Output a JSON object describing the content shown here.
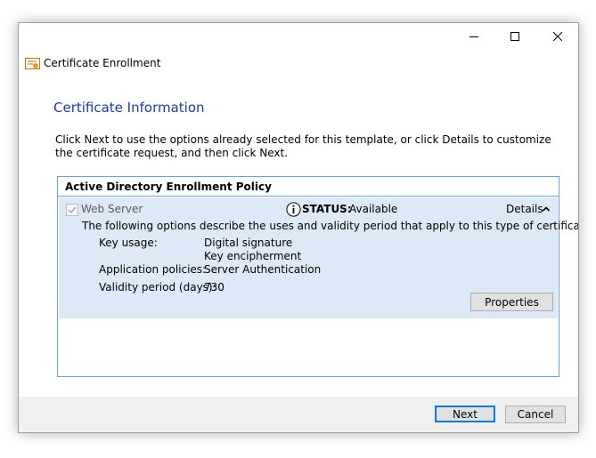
{
  "window": {
    "title": "Certificate Enrollment",
    "controls": [
      "minimize-icon",
      "maximize-icon",
      "close-icon"
    ]
  },
  "page": {
    "heading": "Certificate Information",
    "instructions": "Click Next to use the options already selected for this template, or click Details to customize the certificate request, and then click Next."
  },
  "policy": {
    "header": "Active Directory Enrollment Policy",
    "entry": {
      "checked": true,
      "name": "Web Server",
      "status_label": "STATUS:",
      "status_value": "Available",
      "details_label": "Details",
      "description": "The following options describe the uses and validity period that apply to this type of certificate:",
      "key_usage_label": "Key usage:",
      "key_usage_values": [
        "Digital signature",
        "Key encipherment"
      ],
      "app_policies_label": "Application policies:",
      "app_policies_value": "Server Authentication",
      "validity_label": "Validity period (days):",
      "validity_value": "730",
      "properties_label": "Properties"
    }
  },
  "footer": {
    "next_label": "Next",
    "cancel_label": "Cancel"
  },
  "colors": {
    "heading": "#1f3f8f",
    "entry_background": "#dde9f7",
    "box_border": "#7a9cc8",
    "default_button_border": "#0078d7"
  }
}
